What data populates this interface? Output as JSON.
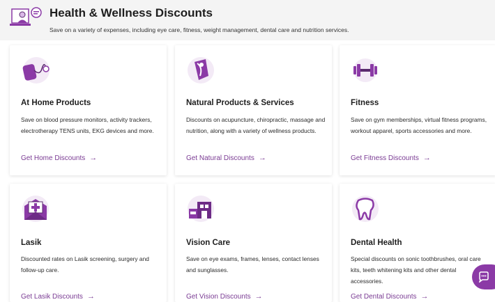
{
  "header": {
    "title": "Health & Wellness Discounts",
    "subtitle": "Save on a variety of expenses, including eye care, fitness, weight management, dental care and nutrition services."
  },
  "cards": [
    {
      "icon": "blood-pressure-monitor-icon",
      "title": "At Home Products",
      "description": "Save on blood pressure monitors, activity trackers, electrotherapy TENS units, EKG devices and more.",
      "link": "Get Home Discounts"
    },
    {
      "icon": "natural-products-icon",
      "title": "Natural Products & Services",
      "description": "Discounts on acupuncture, chiropractic, massage and nutrition, along with a variety of wellness products.",
      "link": "Get Natural Discounts"
    },
    {
      "icon": "dumbbell-icon",
      "title": "Fitness",
      "description": "Save on gym memberships, virtual fitness programs, workout apparel, sports accessories and more.",
      "link": "Get Fitness Discounts"
    },
    {
      "icon": "medical-envelope-icon",
      "title": "Lasik",
      "description": "Discounted rates on Lasik screening, surgery and follow-up care.",
      "link": "Get Lasik Discounts"
    },
    {
      "icon": "eye-care-store-icon",
      "title": "Vision Care",
      "description": "Save on eye exams, frames, lenses, contact lenses and sunglasses.",
      "link": "Get Vision Discounts"
    },
    {
      "icon": "tooth-icon",
      "title": "Dental Health",
      "description": "Special discounts on sonic toothbrushes, oral care kits, teeth whitening kits and other dental accessories.",
      "link": "Get Dental Discounts"
    }
  ],
  "arrow": "→",
  "colors": {
    "accent": "#7a3b93",
    "icon_purple": "#8b3aa6",
    "header_bg": "#f4f4f4"
  }
}
